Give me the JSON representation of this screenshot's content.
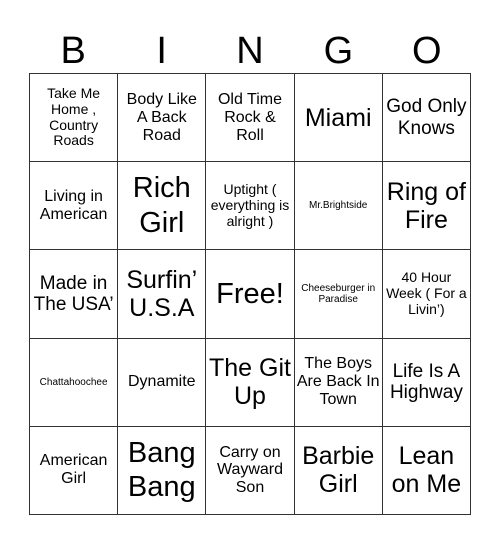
{
  "header": {
    "letters": [
      "B",
      "I",
      "N",
      "G",
      "O"
    ]
  },
  "cells": [
    "Take Me Home , Country Roads",
    "Body Like A Back Road",
    "Old Time Rock & Roll",
    "Miami",
    "God Only Knows",
    "Living in American",
    "Rich Girl",
    "Uptight ( everything is alright )",
    "Mr.Brightside",
    "Ring of Fire",
    "Made in The USA’",
    "Surfin’ U.S.A",
    "Free!",
    "Cheeseburger in Paradise",
    "40 Hour Week ( For a Livin’)",
    "Chattahoochee",
    "Dynamite",
    "The Git Up",
    "The Boys Are Back In Town",
    "Life Is A Highway",
    "American Girl",
    "Bang Bang",
    "Carry on Wayward Son",
    "Barbie Girl",
    "Lean on Me"
  ]
}
